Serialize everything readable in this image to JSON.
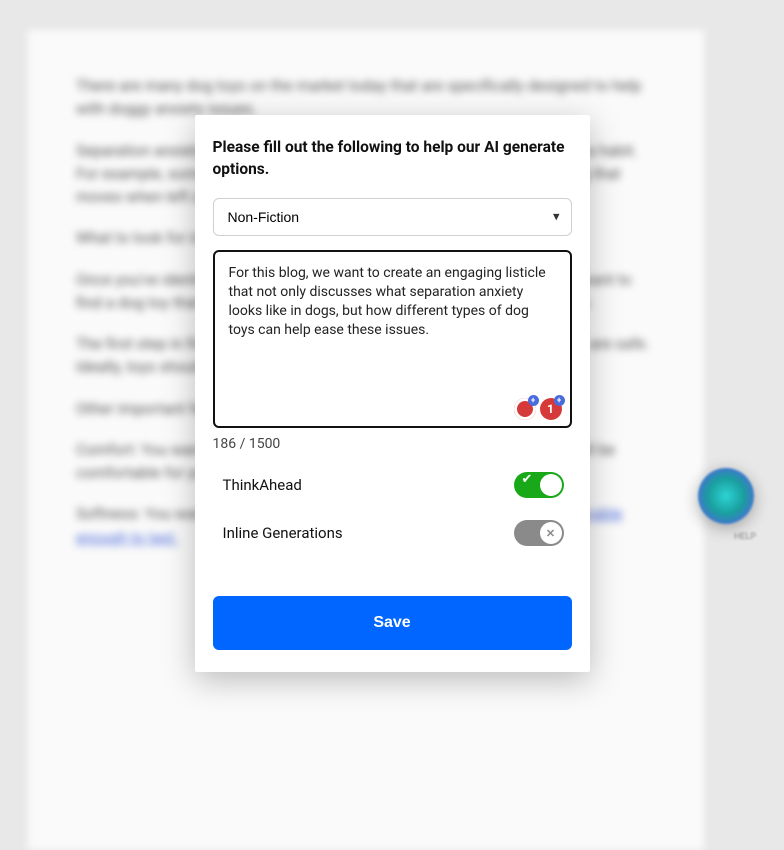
{
  "background": {
    "paragraphs": [
      "There are many dog toys on the market today that are specifically designed to help with doggy anxiety issues.",
      "Separation anxiety in dogs can be a serious issue, especially if it becomes a habit. For example, some dogs can become destructive and chew or eat anything that moves when left alone.",
      "What to look for in an anti-anxiety dog toy",
      "Once you've identified the type of toy that works best with your dog, you'll want to find a dog toy that is safe and durable and that can withstand chewing else.",
      "The first step in finding the right anti-anxiety dog toy is to look for toys that are safe. Ideally, toys should be able to withstand being chewed up.",
      "Other important features to look for when buying a dog toy include:",
      "Comfort: You want to look for a toy that is soft enough to chew and that will be comfortable for your dog to play with.",
      "Softness: You want to look for toys that are soft enough to chew on and durable enough to last."
    ]
  },
  "modal": {
    "title": "Please fill out the following to help our AI generate options.",
    "select": {
      "selected": "Non-Fiction",
      "options": [
        "Non-Fiction"
      ]
    },
    "textarea": {
      "value": "For this blog, we want to create an engaging listicle that not only discusses what separation anxiety looks like in dogs, but how different types of dog toys can help ease these issues. "
    },
    "badges": {
      "count_value": "1"
    },
    "char_count": "186 / 1500",
    "toggles": {
      "think_ahead": {
        "label": "ThinkAhead",
        "on": true
      },
      "inline_gen": {
        "label": "Inline Generations",
        "on": false
      }
    },
    "save_label": "Save"
  },
  "floating": {
    "label": "HELP"
  }
}
